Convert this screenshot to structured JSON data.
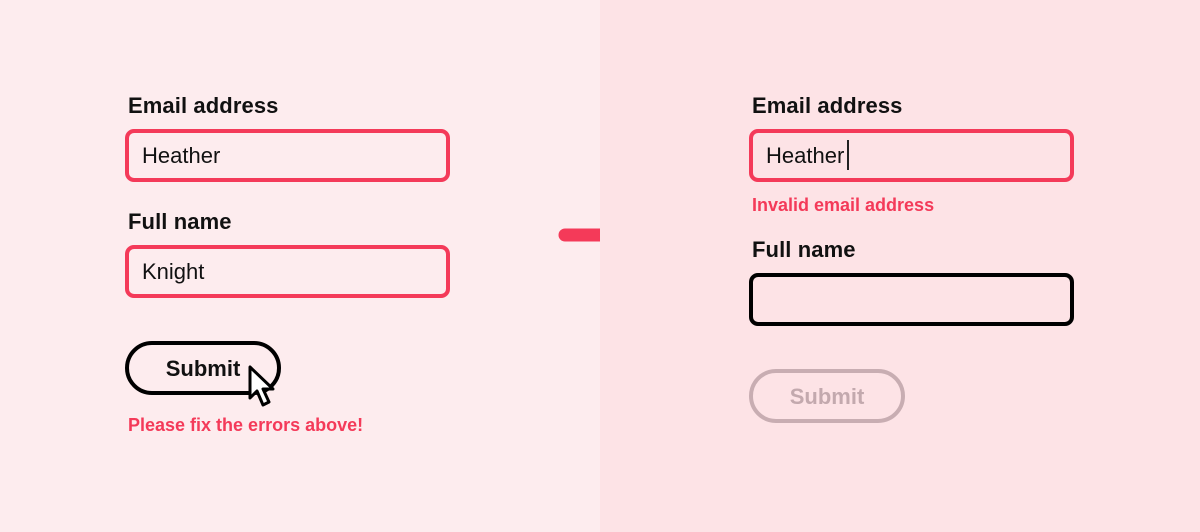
{
  "before": {
    "email_label": "Email address",
    "email_value": "Heather",
    "name_label": "Full name",
    "name_value": "Knight",
    "submit_label": "Submit",
    "form_error": "Please fix the errors above!"
  },
  "after": {
    "email_label": "Email address",
    "email_value": "Heather",
    "email_error": "Invalid email address",
    "name_label": "Full name",
    "name_value": "",
    "submit_label": "Submit"
  },
  "colors": {
    "error": "#f43a59",
    "left_background": "#fdecee",
    "right_background": "#fde3e6",
    "disabled": "#c8adb2"
  },
  "icons": {
    "transition": "arrow-right-icon",
    "pointer": "mouse-pointer-icon"
  }
}
